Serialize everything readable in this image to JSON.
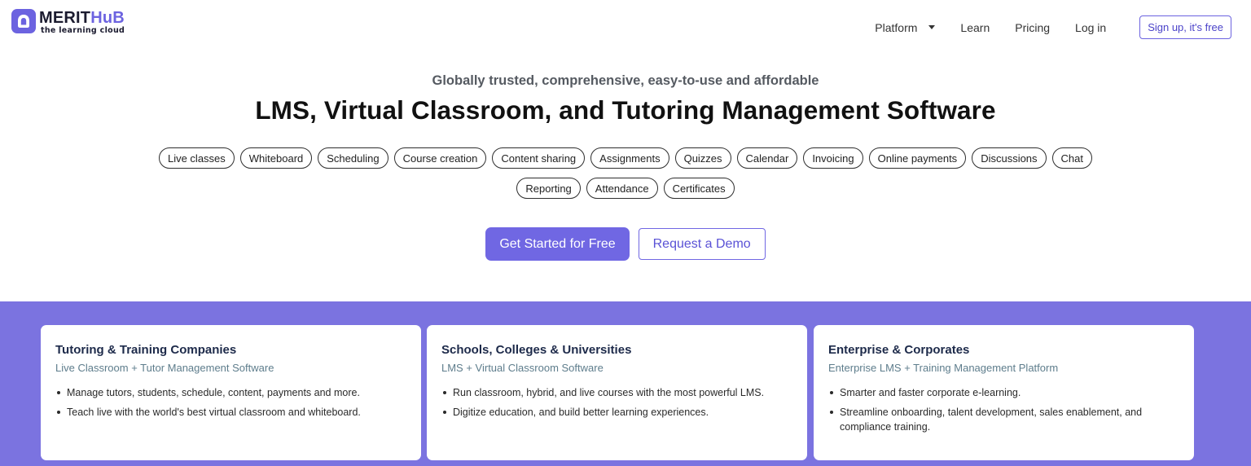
{
  "brand": {
    "name_main": "MERIT",
    "name_accent": "HuB",
    "tagline": "the learning cloud",
    "accent_color": "#6c63e0",
    "icon": "merithub-logo-icon"
  },
  "nav": {
    "platform": "Platform",
    "learn": "Learn",
    "pricing": "Pricing",
    "login": "Log in",
    "signup": "Sign up, it's free"
  },
  "hero": {
    "tagline": "Globally trusted, comprehensive, easy-to-use and affordable",
    "headline": "LMS, Virtual Classroom, and Tutoring Management Software",
    "features_row1": [
      "Live classes",
      "Whiteboard",
      "Scheduling",
      "Course creation",
      "Content sharing",
      "Assignments",
      "Quizzes",
      "Calendar",
      "Invoicing",
      "Online payments",
      "Discussions",
      "Chat"
    ],
    "features_row2": [
      "Reporting",
      "Attendance",
      "Certificates"
    ],
    "cta_primary": "Get Started for Free",
    "cta_secondary": "Request a Demo"
  },
  "segments": {
    "band_color": "#7b73e0",
    "cards": [
      {
        "title": "Tutoring & Training Companies",
        "subtitle": "Live Classroom + Tutor Management Software",
        "bullets": [
          "Manage tutors, students, schedule, content, payments and more.",
          "Teach live with the world's best virtual classroom and whiteboard."
        ]
      },
      {
        "title": "Schools, Colleges & Universities",
        "subtitle": "LMS + Virtual Classroom Software",
        "bullets": [
          "Run classroom, hybrid, and live courses with the most powerful LMS.",
          "Digitize education, and build better learning experiences."
        ]
      },
      {
        "title": "Enterprise & Corporates",
        "subtitle": "Enterprise LMS + Training Management Platform",
        "bullets": [
          "Smarter and faster corporate e-learning.",
          "Streamline onboarding, talent development, sales enablement, and compliance training."
        ]
      }
    ]
  }
}
